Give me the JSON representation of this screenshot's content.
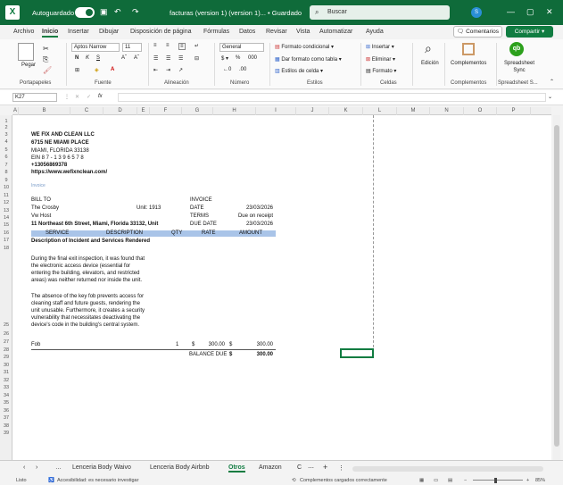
{
  "titlebar": {
    "logo": "X",
    "autosave_label": "Autoguardado",
    "filename": "facturas (version 1) (version 1)... • Guardado",
    "search_placeholder": "Buscar",
    "avatar": "S"
  },
  "ribbon_tabs": [
    "Archivo",
    "Inicio",
    "Insertar",
    "Dibujar",
    "Disposición de página",
    "Fórmulas",
    "Datos",
    "Revisar",
    "Vista",
    "Automatizar",
    "Ayuda"
  ],
  "ribbon_active": "Inicio",
  "buttons": {
    "comments": "Comentarios",
    "share": "Compartir"
  },
  "ribbon": {
    "paste": "Pegar",
    "font_name": "Aptos Narrow",
    "font_size": "11",
    "number_format": "General",
    "cond_format": "Formato condicional",
    "table_format": "Dar formato como tabla",
    "cell_styles": "Estilos de celda",
    "insert": "Insertar",
    "delete": "Eliminar",
    "format": "Formato",
    "edit": "Edición",
    "addins": "Complementos",
    "qb": "Spreadsheet Sync",
    "groups": [
      "Portapapeles",
      "Fuente",
      "Alineación",
      "Número",
      "Estilos",
      "Celdas",
      "Complementos",
      "Spreadsheet S..."
    ]
  },
  "formula_bar": {
    "name_box": "K27",
    "fx": "fx",
    "value": ""
  },
  "columns": [
    "A",
    "B",
    "C",
    "D",
    "E",
    "F",
    "G",
    "H",
    "I",
    "J",
    "K",
    "L",
    "M",
    "N",
    "O",
    "P"
  ],
  "rows": [
    "1",
    "2",
    "3",
    "4",
    "5",
    "6",
    "7",
    "8",
    "9",
    "10",
    "11",
    "12",
    "13",
    "14",
    "15",
    "16",
    "17",
    "18",
    "25",
    "26",
    "27",
    "28",
    "29",
    "30",
    "31",
    "32",
    "33",
    "34",
    "35",
    "36",
    "37",
    "38",
    "39"
  ],
  "invoice": {
    "company": "WE FIX AND CLEAN LLC",
    "address1": "6715 NE MIAMI PLACE",
    "address2": "MIAMI, FLORIDA 33138",
    "ein": "EIN 8 7 - 1 3 9 6 5 7 8",
    "phone": "+13056869378",
    "web": "https://www.wefixnclean.com/",
    "invoice_small": "Invoice",
    "bill_to": "BILL TO",
    "client": "The Crosby",
    "unit": "Unit: 1913",
    "host": "Vw Host",
    "address": "11 Northeast 6th Street, Miami, Florida 33132, Unit",
    "invoice_label": "INVOICE",
    "date_label": "DATE",
    "date_value": "23/03/2026",
    "terms_label": "TERMS",
    "terms_value": "Due on receipt",
    "due_label": "DUE DATE",
    "due_value": "23/03/2026",
    "col_service": "SERVICE",
    "col_description": "DESCRIPTION",
    "col_qty": "QTY",
    "col_rate": "RATE",
    "col_amount": "AMOUNT",
    "desc_title": "Description of Incident and Services Rendered",
    "para1": [
      "During the final exit inspection, it was found that",
      "the electronic access device (essential for",
      "entering the building, elevators, and restricted",
      "areas) was neither returned nor inside the unit."
    ],
    "para2": [
      "The absence of the key fob prevents access for",
      "cleaning staff and future guests, rendering the",
      "unit unusable. Furthermore, it creates a security",
      "vulnerability that necessitates deactivating the",
      "device's code in the building's central system."
    ],
    "item": "Fob",
    "qty": "1",
    "currency": "$",
    "rate": "300.00",
    "amount": "300.00",
    "balance_label": "BALANCE DUE",
    "balance_value": "300.00"
  },
  "sheet_tabs": [
    "Lenceria Body Waivo",
    "Lenceria Body Airbnb",
    "Otros",
    "Amazon",
    "C"
  ],
  "active_sheet": "Otros",
  "status": {
    "ready": "Listo",
    "accessibility": "Accesibilidad: es necesario investigar",
    "addins": "Complementos cargados correctamente",
    "zoom": "85%"
  }
}
